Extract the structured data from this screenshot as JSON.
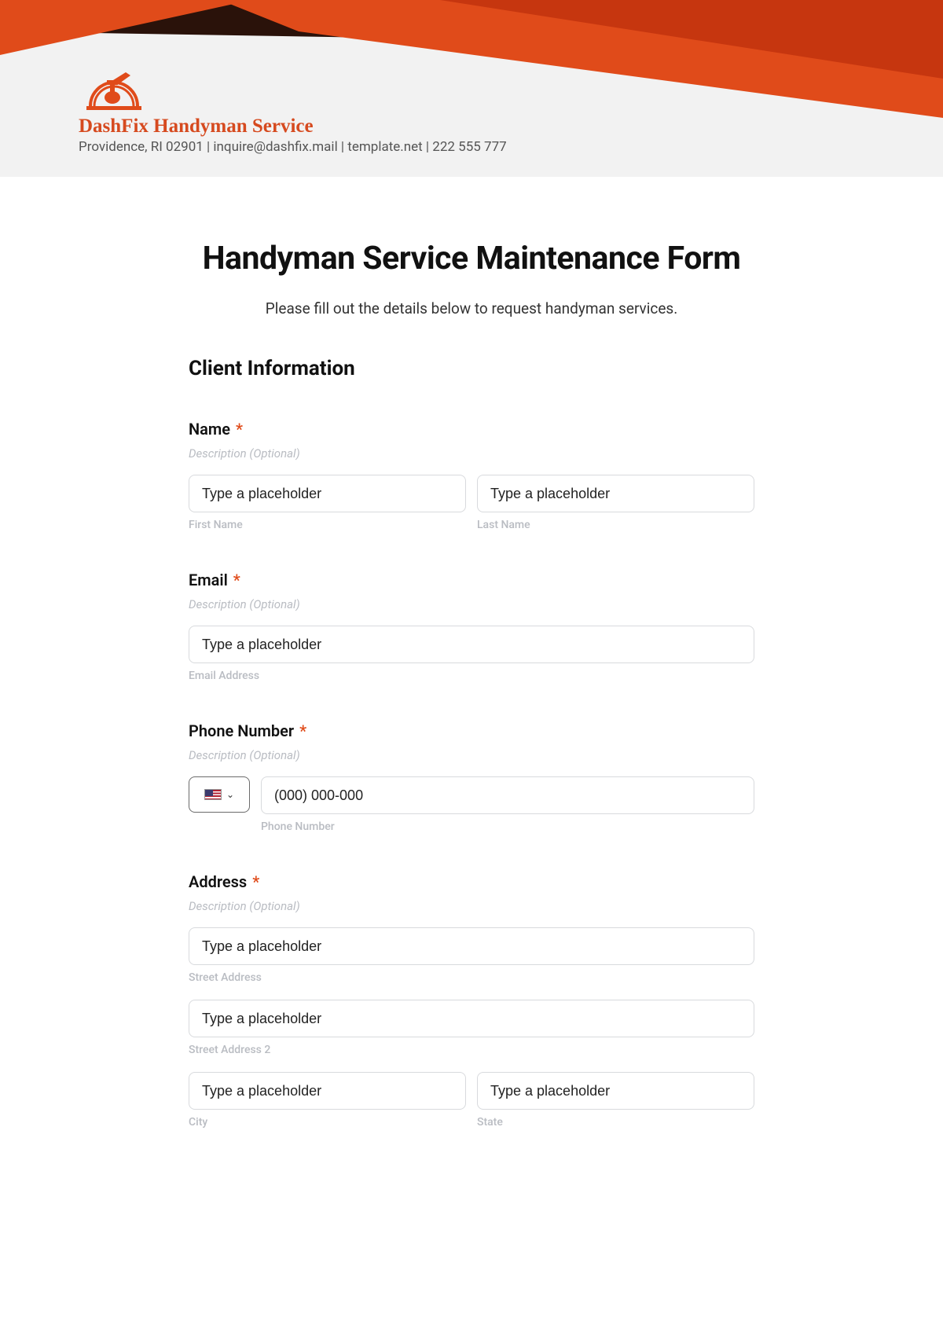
{
  "brand": {
    "name": "DashFix Handyman Service",
    "info": "Providence, RI 02901 | inquire@dashfix.mail | template.net | 222 555 777"
  },
  "form": {
    "title": "Handyman Service Maintenance Form",
    "subtitle": "Please fill out the details below to request handyman services."
  },
  "section": {
    "client_info": "Client Information"
  },
  "fields": {
    "name": {
      "label": "Name",
      "required": "*",
      "desc": "Description (Optional)",
      "first_placeholder": "Type a placeholder",
      "first_sub": "First Name",
      "last_placeholder": "Type a placeholder",
      "last_sub": "Last Name"
    },
    "email": {
      "label": "Email",
      "required": "*",
      "desc": "Description (Optional)",
      "placeholder": "Type a placeholder",
      "sub": "Email Address"
    },
    "phone": {
      "label": "Phone Number",
      "required": "*",
      "desc": "Description (Optional)",
      "placeholder": "(000) 000-000",
      "sub": "Phone Number"
    },
    "address": {
      "label": "Address",
      "required": "*",
      "desc": "Description (Optional)",
      "street_placeholder": "Type a placeholder",
      "street_sub": "Street Address",
      "street2_placeholder": "Type a placeholder",
      "street2_sub": "Street Address 2",
      "city_placeholder": "Type a placeholder",
      "city_sub": "City",
      "state_placeholder": "Type a placeholder",
      "state_sub": "State"
    }
  }
}
